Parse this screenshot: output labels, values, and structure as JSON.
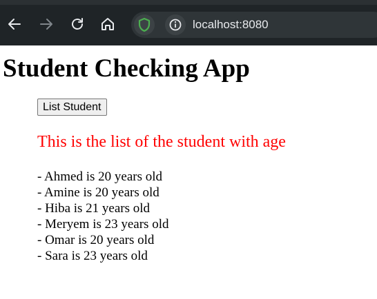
{
  "browser": {
    "url": "localhost:8080",
    "icons": {
      "back": "arrow-left-icon",
      "forward": "arrow-right-icon",
      "reload": "reload-icon",
      "home": "home-icon",
      "shield": "shield-icon",
      "info": "info-icon"
    },
    "colors": {
      "toolbar": "#1f2427",
      "address_bar": "#2f3538",
      "shield": "#4caf50"
    }
  },
  "page": {
    "title": "Student Checking App",
    "list_button_label": "List Student",
    "subtitle": "This is the list of the student with age",
    "subtitle_color": "#ff0000",
    "students": [
      "- Ahmed is 20 years old",
      "- Amine is 20 years old",
      "- Hiba is 21 years old",
      "- Meryem is 23 years old",
      "- Omar is 20 years old",
      "- Sara is 23 years old"
    ]
  }
}
